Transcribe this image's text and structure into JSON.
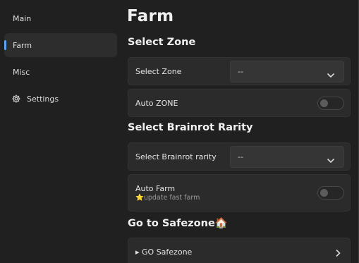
{
  "sidebar": {
    "items": [
      {
        "label": "Main"
      },
      {
        "label": "Farm"
      },
      {
        "label": "Misc"
      },
      {
        "label": "Settings",
        "icon": "gear-icon"
      }
    ],
    "active_index": 1,
    "accent_color": "#5aa6f0"
  },
  "page": {
    "title": "Farm"
  },
  "sections": {
    "zone": {
      "title": "Select Zone",
      "dropdown_label": "Select Zone",
      "dropdown_value": "--",
      "toggle_label": "Auto ZONE",
      "toggle_on": false
    },
    "rarity": {
      "title": "Select Brainrot Rarity",
      "dropdown_label": "Select Brainrot rarity",
      "dropdown_value": "--",
      "toggle_label": "Auto Farm",
      "toggle_note": "⭐update fast farm",
      "toggle_on": false
    },
    "safezone": {
      "title": "Go to Safezone🏠",
      "button_label": "▸ GO Safezone"
    }
  }
}
